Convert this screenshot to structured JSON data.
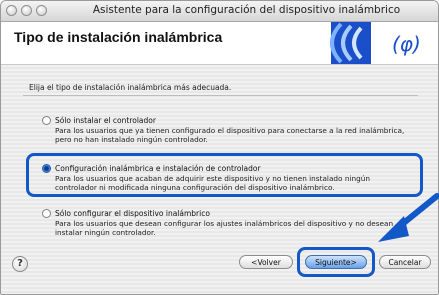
{
  "window": {
    "title": "Asistente para la configuración del dispositivo inalámbrico"
  },
  "header": {
    "title": "Tipo de instalación inalámbrica",
    "logo_icon": "wireless-signal-logo"
  },
  "instruction": "Elija el tipo de instalación inalámbrica más adecuada.",
  "options": [
    {
      "label": "Sólo instalar el controlador",
      "description": "Para los usuarios que ya tienen configurado el dispositivo para conectarse a la red inalámbrica, pero no han instalado ningún controlador.",
      "selected": false
    },
    {
      "label": "Configuración inalámbrica e instalación de controlador",
      "description": "Para los usuarios que acaban de adquirir este dispositivo y no tienen instalado ningún controlador ni modificada ninguna configuración del dispositivo inalámbrico.",
      "selected": true
    },
    {
      "label": "Sólo configurar el dispositivo inalámbrico",
      "description": "Para los usuarios que desean configurar los ajustes inalámbricos del dispositivo y no desean instalar ningún controlador.",
      "selected": false
    }
  ],
  "buttons": {
    "help": "?",
    "back": "<Volver",
    "next": "Siguiente>",
    "cancel": "Cancelar"
  },
  "colors": {
    "highlight": "#1259c7",
    "logo_blue": "#1a4fc9"
  }
}
